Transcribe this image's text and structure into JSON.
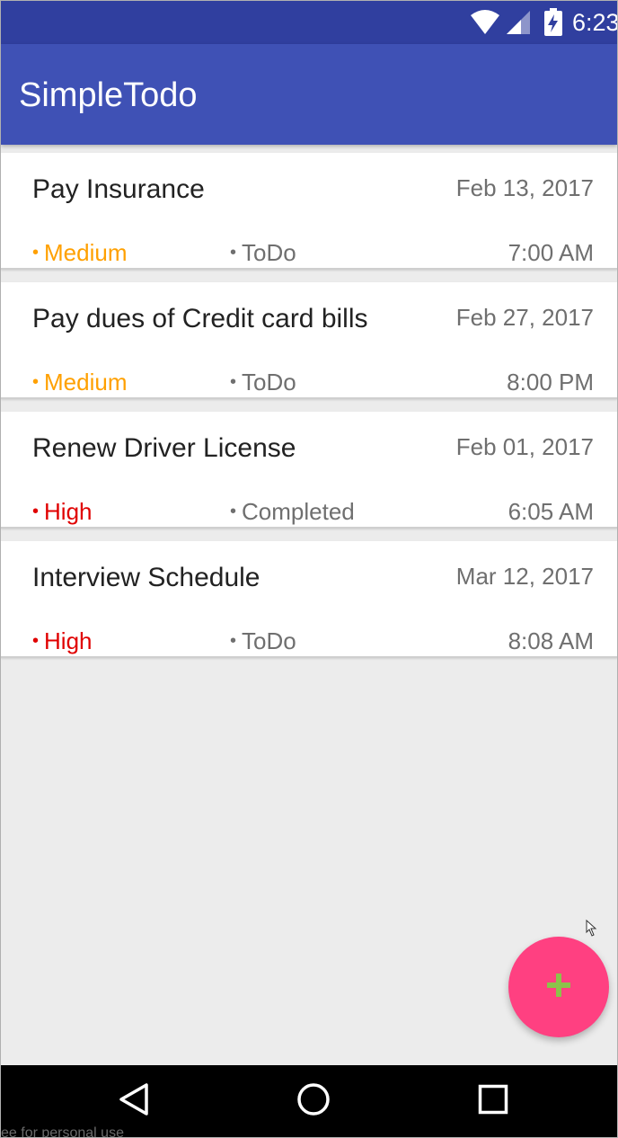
{
  "status_bar": {
    "time": "6:23",
    "icons": [
      "wifi-icon",
      "cellular-signal-icon",
      "battery-charging-icon"
    ]
  },
  "app_bar": {
    "title": "SimpleTodo"
  },
  "tasks": [
    {
      "title": "Pay Insurance",
      "date": "Feb 13, 2017",
      "priority": "Medium",
      "status": "ToDo",
      "time": "7:00 AM"
    },
    {
      "title": "Pay dues of Credit card bills",
      "date": "Feb 27, 2017",
      "priority": "Medium",
      "status": "ToDo",
      "time": "8:00 PM"
    },
    {
      "title": "Renew Driver License",
      "date": "Feb 01, 2017",
      "priority": "High",
      "status": "Completed",
      "time": "6:05 AM"
    },
    {
      "title": "Interview Schedule",
      "date": "Mar 12, 2017",
      "priority": "High",
      "status": "ToDo",
      "time": "8:08 AM"
    }
  ],
  "colors": {
    "status_bar": "#303f9f",
    "app_bar": "#3f51b5",
    "fab": "#ff4081",
    "fab_icon": "#8bc34a",
    "priority_medium": "#ffa000",
    "priority_high": "#e00000",
    "background": "#ececec"
  },
  "fab": {
    "icon": "plus-icon"
  },
  "nav_bar": {
    "icons": [
      "back-icon",
      "home-icon",
      "recents-icon"
    ]
  },
  "watermark": "ee for personal use"
}
